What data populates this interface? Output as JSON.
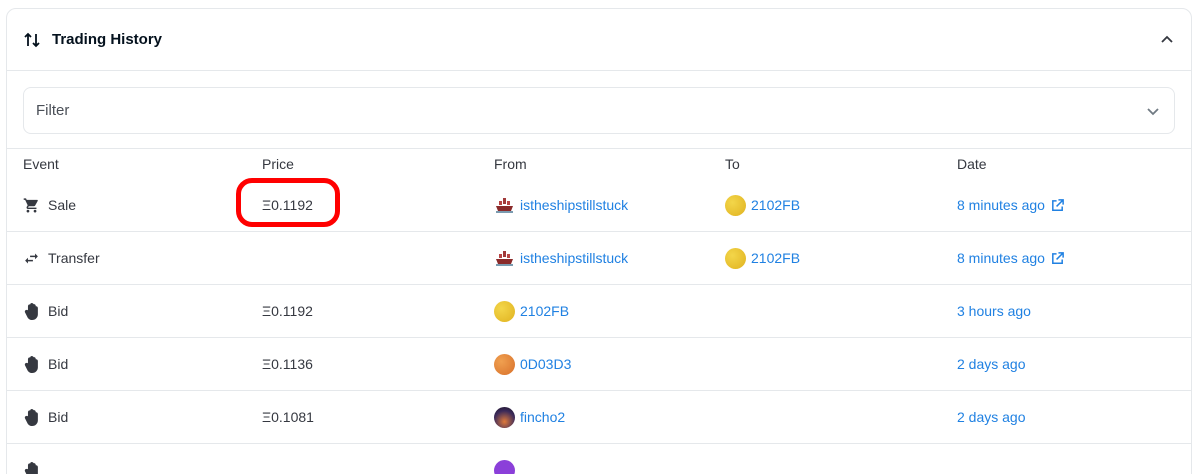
{
  "panel": {
    "title": "Trading History",
    "title_icon": "swap-vertical-icon",
    "collapse_icon": "chevron-up-icon"
  },
  "filter": {
    "placeholder": "Filter",
    "icon": "chevron-down-icon"
  },
  "table": {
    "headers": {
      "event": "Event",
      "price": "Price",
      "from": "From",
      "to": "To",
      "date": "Date"
    },
    "currency_symbol": "Ξ",
    "rows": [
      {
        "event": "Sale",
        "event_icon": "cart-icon",
        "price": "0.1192",
        "from": "istheshipstillstuck",
        "from_avatar": "ship-avatar",
        "to": "2102FB",
        "to_color": "#e6c02a",
        "date": "8 minutes ago",
        "has_link": true
      },
      {
        "event": "Transfer",
        "event_icon": "transfer-arrows-icon",
        "price": "",
        "from": "istheshipstillstuck",
        "from_avatar": "ship-avatar",
        "to": "2102FB",
        "to_color": "#e6c02a",
        "date": "8 minutes ago",
        "has_link": true
      },
      {
        "event": "Bid",
        "event_icon": "hand-icon",
        "price": "0.1192",
        "from": "2102FB",
        "from_color": "#e6c02a",
        "to": "",
        "date": "3 hours ago",
        "has_link": false
      },
      {
        "event": "Bid",
        "event_icon": "hand-icon",
        "price": "0.1136",
        "from": "0D03D3",
        "from_color": "#e0822f",
        "to": "",
        "date": "2 days ago",
        "has_link": false
      },
      {
        "event": "Bid",
        "event_icon": "hand-icon",
        "price": "0.1081",
        "from": "fincho2",
        "from_color": "#3b2a5a",
        "to": "",
        "date": "2 days ago",
        "has_link": false
      }
    ]
  },
  "colors": {
    "link": "#2081e2",
    "border": "#e5e8eb",
    "highlight": "#ff0000"
  }
}
